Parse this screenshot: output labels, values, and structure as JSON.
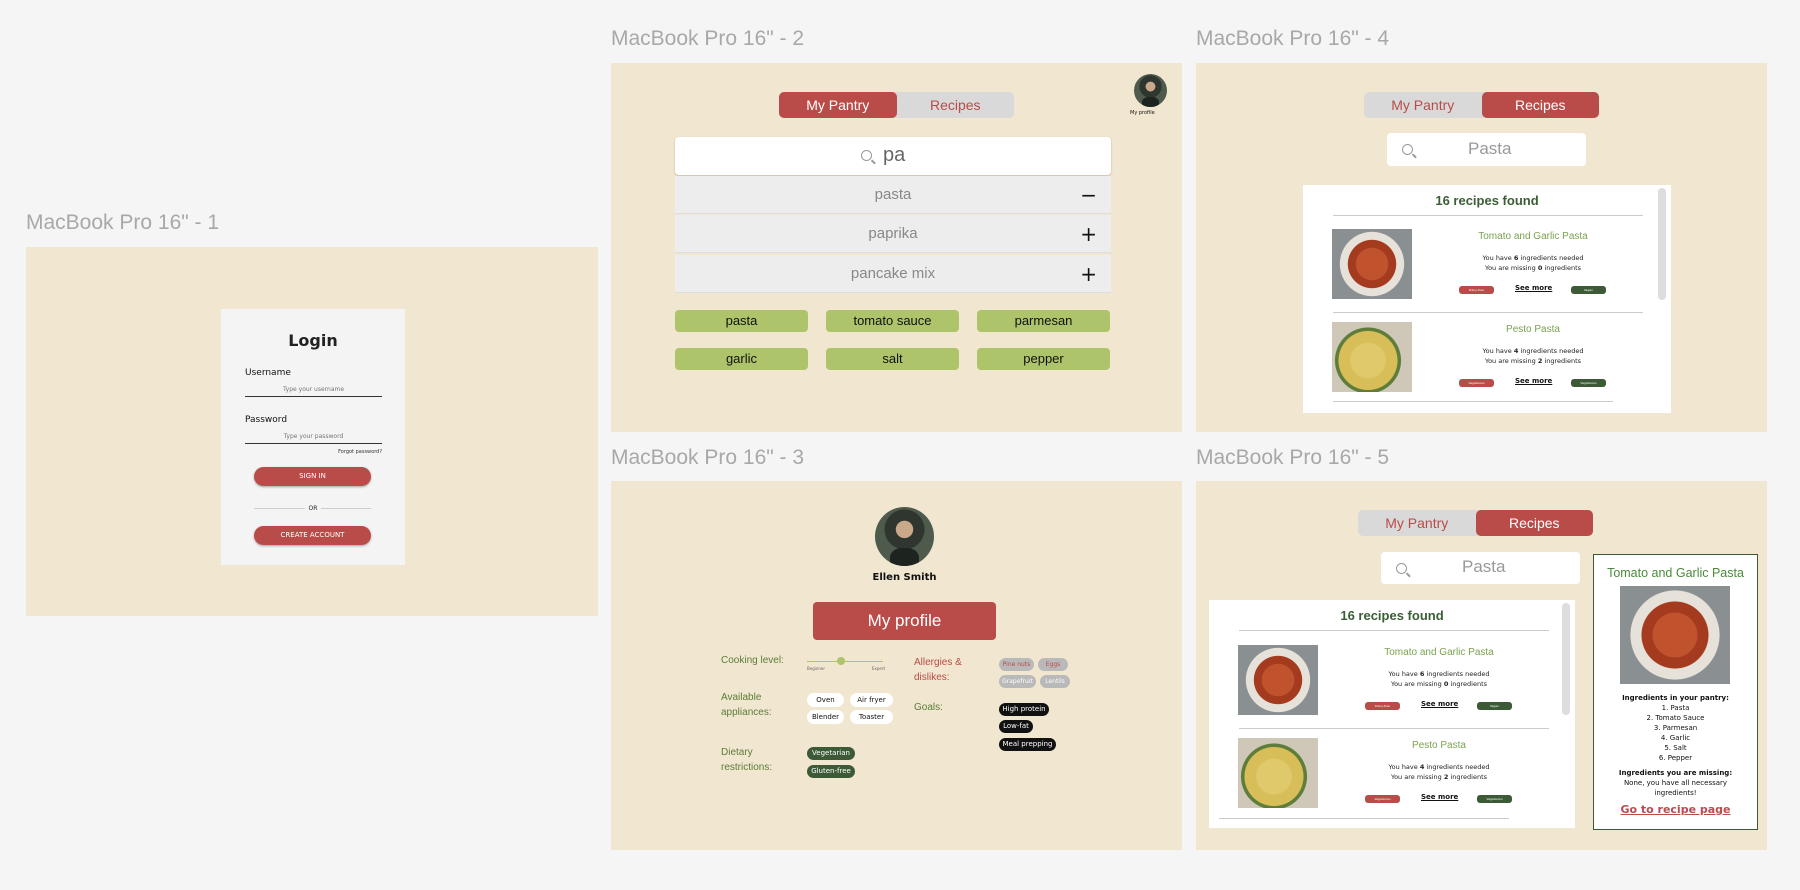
{
  "frames": {
    "f1": "MacBook Pro 16\" - 1",
    "f2": "MacBook Pro 16\" - 2",
    "f3": "MacBook Pro 16\" - 3",
    "f4": "MacBook Pro 16\" - 4",
    "f5": "MacBook Pro 16\" - 5"
  },
  "login": {
    "title": "Login",
    "username_label": "Username",
    "username_placeholder": "Type your username",
    "password_label": "Password",
    "password_placeholder": "Type your password",
    "forgot": "Forgot password?",
    "sign_in": "SIGN IN",
    "or": "OR",
    "create": "CREATE ACCOUNT"
  },
  "tabs": {
    "pantry": "My Pantry",
    "recipes": "Recipes"
  },
  "profile_caption": "My profile",
  "pantry": {
    "query": "pa",
    "suggestions": [
      {
        "label": "pasta",
        "action": "−"
      },
      {
        "label": "paprika",
        "action": "+"
      },
      {
        "label": "pancake mix",
        "action": "+"
      }
    ],
    "items": [
      "pasta",
      "tomato sauce",
      "parmesan",
      "garlic",
      "salt",
      "pepper"
    ]
  },
  "recipes": {
    "query": "Pasta",
    "count": "16 recipes found",
    "list": [
      {
        "name": "Tomato and Garlic Pasta",
        "have_pre": "You have ",
        "have_n": "6",
        "have_post": " ingredients needed",
        "miss_pre": "You are missing ",
        "miss_n": "0",
        "miss_post": " ingredients",
        "tag1": "Dairy-free",
        "see": "See more",
        "tag2": "Vegan"
      },
      {
        "name": "Pesto Pasta",
        "have_pre": "You have ",
        "have_n": "4",
        "have_post": " ingredients needed",
        "miss_pre": "You are missing ",
        "miss_n": "2",
        "miss_post": " ingredients",
        "tag1": "Vegetarian",
        "see": "See more",
        "tag2": "Vegetarian"
      }
    ]
  },
  "profile": {
    "name": "Ellen Smith",
    "button": "My profile",
    "cooking_level": "Cooking level:",
    "beginner": "Beginner",
    "expert": "Expert",
    "cooking_value": 0.45,
    "appliances_label": "Available appliances:",
    "appliances": [
      "Oven",
      "Air fryer",
      "Blender",
      "Toaster"
    ],
    "dietary_label": "Dietary restrictions:",
    "dietary": [
      "Vegetarian",
      "Gluten-free"
    ],
    "allergies_label": "Allergies & dislikes:",
    "allergies": [
      "Pine nuts",
      "Eggs",
      "Grapefruit",
      "Lentils"
    ],
    "goals_label": "Goals:",
    "goals": [
      "High protein",
      "Low-fat",
      "Meal prepping"
    ]
  },
  "detail": {
    "title": "Tomato and Garlic Pasta",
    "have_heading": "Ingredients in your pantry:",
    "have_list": [
      "1. Pasta",
      "2. Tomato Sauce",
      "3. Parmesan",
      "4. Garlic",
      "5. Salt",
      "6. Pepper"
    ],
    "miss_heading": "Ingredients you are missing:",
    "miss_text_1": "None, you have all necessary",
    "miss_text_2": "ingredients!",
    "link": "Go to recipe page"
  },
  "colors": {
    "accent": "#b94c49",
    "green": "#adc46a",
    "dark_green": "#3c5a36",
    "frame_bg": "#f1e6cf"
  }
}
